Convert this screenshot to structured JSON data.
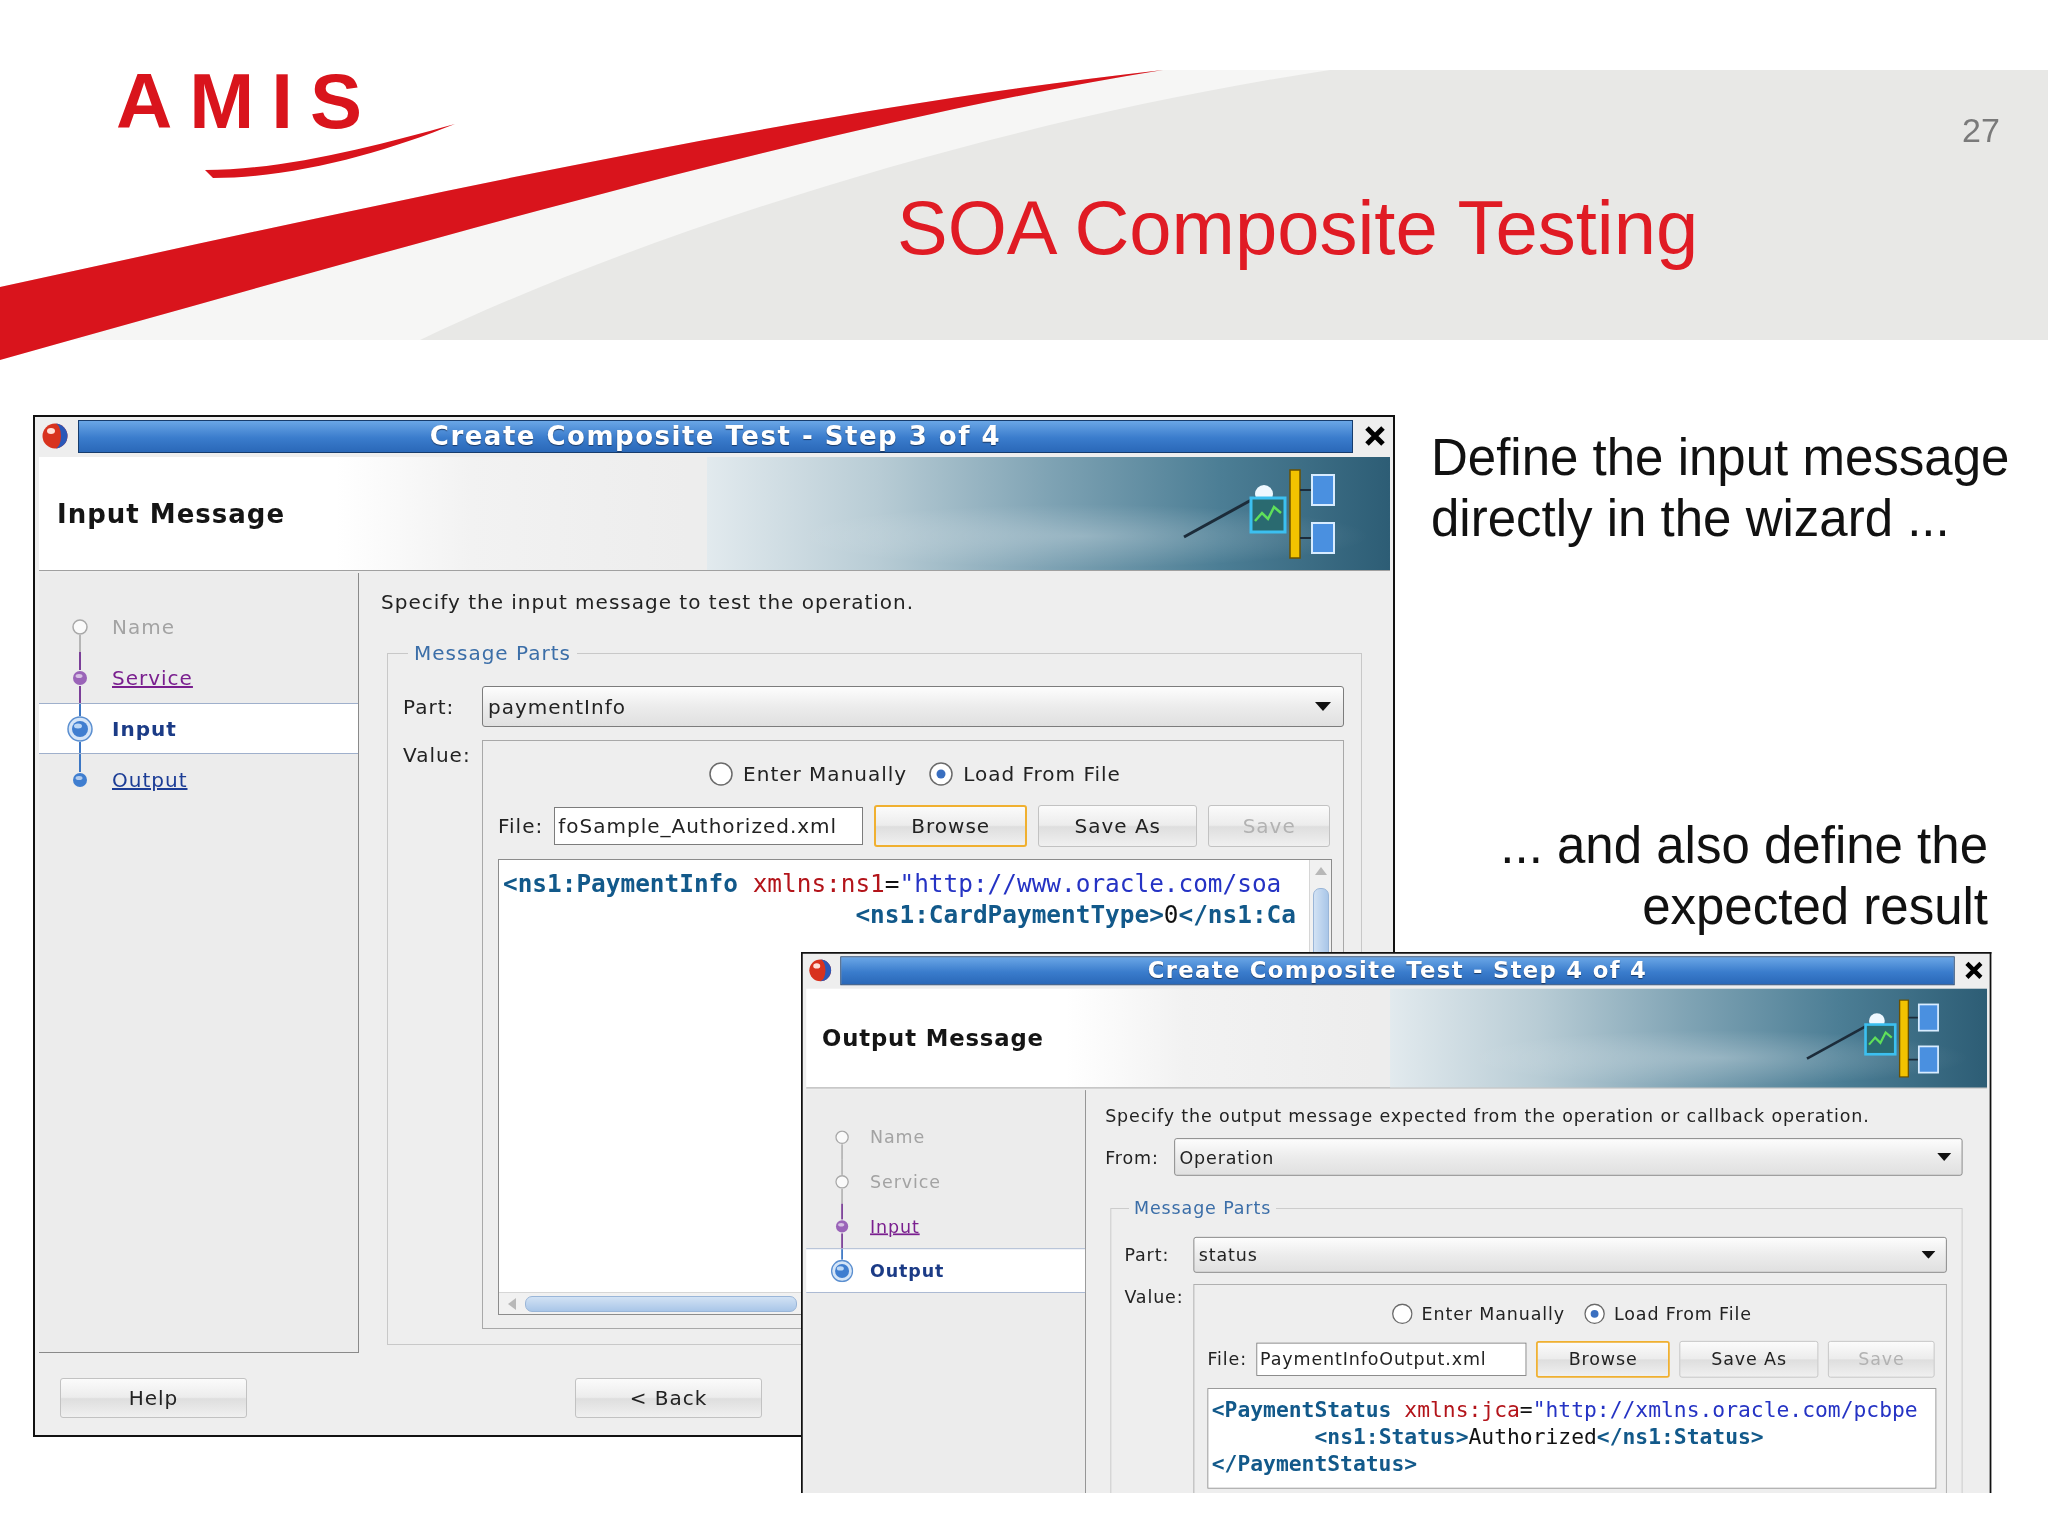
{
  "slide": {
    "logo": "AMIS",
    "page_number": "27",
    "title": "SOA Composite Testing"
  },
  "notes": [
    "Define the input message directly in the wizard ...",
    "... and also define the expected result"
  ],
  "dialogs": [
    {
      "title": "Create Composite Test - Step 3 of 4",
      "heading": "Input Message",
      "steps": [
        {
          "label": "Name",
          "selected": false,
          "visited": false,
          "disabled": true
        },
        {
          "label": "Service",
          "selected": false,
          "visited": true,
          "disabled": false
        },
        {
          "label": "Input",
          "selected": true,
          "visited": false,
          "disabled": false
        },
        {
          "label": "Output",
          "selected": false,
          "visited": false,
          "disabled": false
        }
      ],
      "instruction": "Specify the input message to test the operation.",
      "group_title": "Message Parts",
      "part": {
        "label": "Part:",
        "value": "paymentInfo"
      },
      "value_label": "Value:",
      "source_options": [
        {
          "label": "Enter Manually",
          "selected": false
        },
        {
          "label": "Load From File",
          "selected": true
        }
      ],
      "file": {
        "label": "File:",
        "value": "foSample_Authorized.xml"
      },
      "file_buttons": [
        {
          "label": "Browse",
          "focused": true,
          "disabled": false
        },
        {
          "label": "Save As",
          "focused": false,
          "disabled": false
        },
        {
          "label": "Save",
          "focused": false,
          "disabled": true
        }
      ],
      "xml_lines": [
        {
          "segments": [
            {
              "kind": "tag",
              "text": "<ns1:PaymentInfo"
            },
            {
              "kind": "attr",
              "text": " xmlns:ns1"
            },
            {
              "kind": "text",
              "text": "="
            },
            {
              "kind": "value",
              "text": "\"http://www.oracle.com/soa"
            }
          ]
        },
        {
          "segments": [
            {
              "kind": "tag",
              "text": "                        <ns1:CardPaymentType>"
            },
            {
              "kind": "text",
              "text": "0"
            },
            {
              "kind": "tag",
              "text": "</ns1:Ca"
            }
          ]
        }
      ],
      "footer_buttons": [
        {
          "label": "Help"
        },
        {
          "label": "< Back"
        }
      ]
    },
    {
      "title": "Create Composite Test - Step 4 of 4",
      "heading": "Output Message",
      "steps": [
        {
          "label": "Name",
          "selected": false,
          "visited": false,
          "disabled": true
        },
        {
          "label": "Service",
          "selected": false,
          "visited": false,
          "disabled": true
        },
        {
          "label": "Input",
          "selected": false,
          "visited": true,
          "disabled": false
        },
        {
          "label": "Output",
          "selected": true,
          "visited": false,
          "disabled": false
        }
      ],
      "instruction": "Specify the output message expected from the operation or callback operation.",
      "from": {
        "label": "From:",
        "value": "Operation"
      },
      "group_title": "Message Parts",
      "part": {
        "label": "Part:",
        "value": "status"
      },
      "value_label": "Value:",
      "source_options": [
        {
          "label": "Enter Manually",
          "selected": false
        },
        {
          "label": "Load From File",
          "selected": true
        }
      ],
      "file": {
        "label": "File:",
        "value": "PaymentInfoOutput.xml"
      },
      "file_buttons": [
        {
          "label": "Browse",
          "focused": true,
          "disabled": false
        },
        {
          "label": "Save As",
          "focused": false,
          "disabled": false
        },
        {
          "label": "Save",
          "focused": false,
          "disabled": true
        }
      ],
      "xml_lines": [
        {
          "segments": [
            {
              "kind": "tag",
              "text": "<PaymentStatus"
            },
            {
              "kind": "attr",
              "text": " xmlns:jca"
            },
            {
              "kind": "text",
              "text": "="
            },
            {
              "kind": "value",
              "text": "\"http://xmlns.oracle.com/pcbpe"
            }
          ]
        },
        {
          "segments": [
            {
              "kind": "tag",
              "text": "        <ns1:Status>"
            },
            {
              "kind": "text",
              "text": "Authorized"
            },
            {
              "kind": "tag",
              "text": "</ns1:Status>"
            }
          ]
        },
        {
          "segments": [
            {
              "kind": "tag",
              "text": "</PaymentStatus>"
            }
          ]
        }
      ]
    }
  ]
}
